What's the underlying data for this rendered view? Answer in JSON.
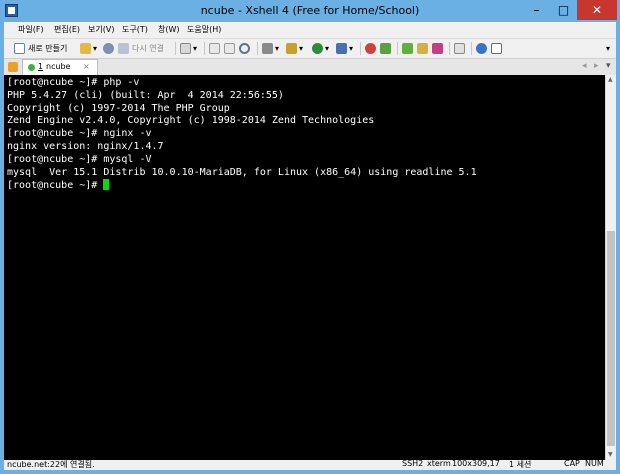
{
  "window": {
    "title": "ncube - Xshell 4 (Free for Home/School)",
    "min_glyph": "–",
    "max_glyph": "□",
    "close_glyph": "✕"
  },
  "menu": [
    "파일(F)",
    "편집(E)",
    "보기(V)",
    "도구(T)",
    "창(W)",
    "도움말(H)"
  ],
  "toolbar": {
    "new_session": "새로 만들기",
    "reconnect": "다시 연결",
    "icons": [
      "new-session-icon",
      "open-folder-icon",
      "link-icon",
      "reconnect-icon",
      "properties-icon",
      "copy-icon",
      "paste-icon",
      "find-icon",
      "print-icon",
      "transfer-icon",
      "globe-icon",
      "user-icon",
      "xftp-icon",
      "compose-icon",
      "layout-icon",
      "lock-icon",
      "keyboard-icon",
      "help-icon",
      "chat-icon"
    ]
  },
  "tabs": [
    {
      "number": "1",
      "label": "ncube",
      "close": "×"
    }
  ],
  "tabbar": {
    "prev": "◂",
    "next": "▸",
    "menu": "▾"
  },
  "terminal": {
    "lines": [
      "[root@ncube ~]# php -v",
      "PHP 5.4.27 (cli) (built: Apr  4 2014 22:56:55)",
      "Copyright (c) 1997-2014 The PHP Group",
      "Zend Engine v2.4.0, Copyright (c) 1998-2014 Zend Technologies",
      "[root@ncube ~]# nginx -v",
      "nginx version: nginx/1.4.7",
      "[root@ncube ~]# mysql -V",
      "mysql  Ver 15.1 Distrib 10.0.10-MariaDB, for Linux (x86_64) using readline 5.1",
      "[root@ncube ~]# "
    ],
    "cursor_color": "#00e000",
    "background": "#000000",
    "foreground": "#ffffff"
  },
  "status": {
    "connection": "ncube.net:22에 연결됨.",
    "protocol": "SSH2",
    "terminal_type": "xterm",
    "size": "100x30",
    "cursor_pos": "9,17",
    "sessions": "1 세션",
    "caps": "CAP",
    "num": "NUM"
  },
  "colors": {
    "title_bar": "#6ab0e5",
    "close_button": "#c7372f"
  }
}
